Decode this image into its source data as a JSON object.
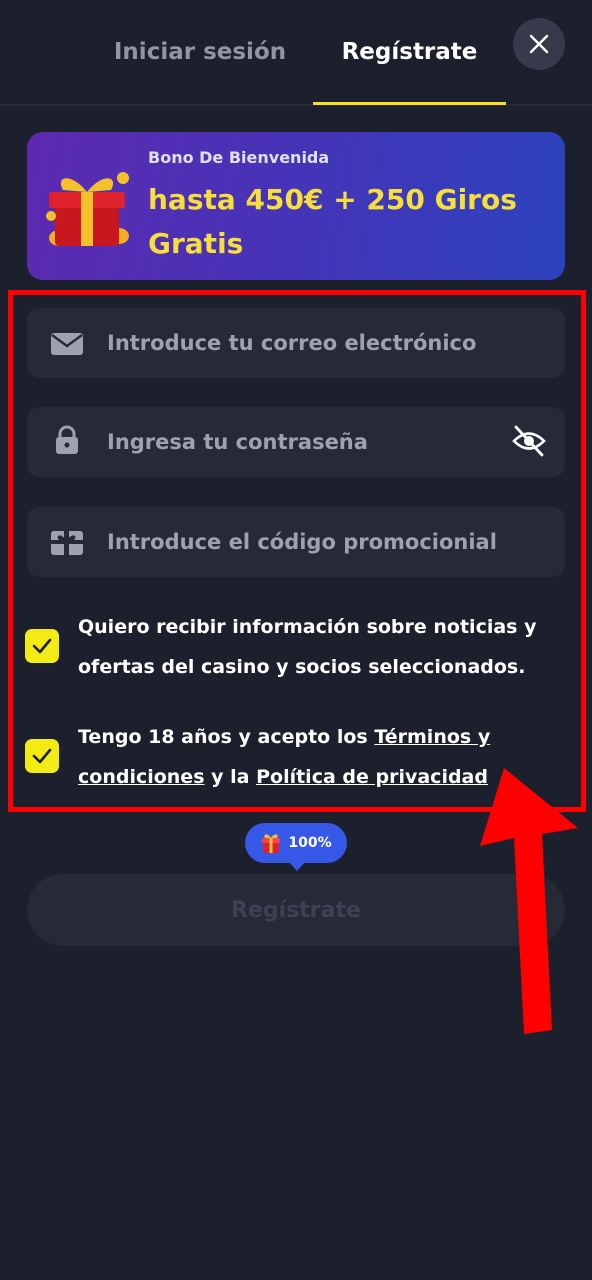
{
  "tabs": {
    "login": "Iniciar sesión",
    "register": "Regístrate"
  },
  "banner": {
    "subtitle": "Bono De Bienvenida",
    "title": "hasta 450€ + 250 Giros Gratis"
  },
  "form": {
    "email_placeholder": "Introduce tu correo electrónico",
    "password_placeholder": "Ingresa tu contraseña",
    "promo_placeholder": "Introduce el código promocionial"
  },
  "consent": {
    "news_text": "Quiero recibir información sobre noticias y ofertas del casino y socios seleccionados.",
    "terms_prefix": "Tengo 18 años y acepto los ",
    "terms_link": "Términos y condiciones",
    "terms_middle": " y la ",
    "privacy_link": "Política de privacidad",
    "news_checked": true,
    "terms_checked": true
  },
  "progress": {
    "label": "100%"
  },
  "submit_label": "Regístrate",
  "colors": {
    "background": "#1c1f2c",
    "accent": "#f5e021",
    "checkbox": "#f3eb14",
    "highlight": "#ff0000",
    "pill": "#3558e6"
  },
  "icons": {
    "close": "close-icon",
    "gift": "gift-icon",
    "email": "envelope-icon",
    "password": "lock-icon",
    "visibility": "eye-off-icon",
    "promo": "gift-card-icon",
    "check": "check-icon",
    "arrow": "red-arrow-annotation"
  }
}
